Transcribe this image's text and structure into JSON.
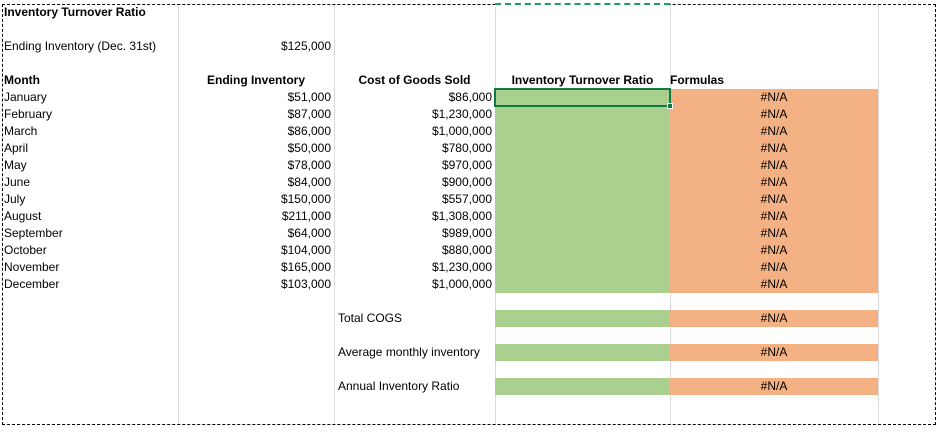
{
  "colors": {
    "green_fill": "#a9d08e",
    "orange_fill": "#f4b183",
    "selection_green": "#107c41",
    "marquee_green": "#1aa05a",
    "gridline": "#d9d9d9"
  },
  "sheet": {
    "title": "Inventory Turnover Ratio",
    "top_label": "Ending Inventory (Dec. 31st)",
    "top_value": "$125,000"
  },
  "table": {
    "headers": [
      "Month",
      "Ending Inventory",
      "Cost of Goods Sold",
      "Inventory Turnover Ratio",
      "Formulas"
    ],
    "rows": [
      {
        "month": "January",
        "ending_inventory": "$51,000",
        "cogs": "$86,000",
        "turnover_ratio": "",
        "formula": "#N/A"
      },
      {
        "month": "February",
        "ending_inventory": "$87,000",
        "cogs": "$1,230,000",
        "turnover_ratio": "",
        "formula": "#N/A"
      },
      {
        "month": "March",
        "ending_inventory": "$86,000",
        "cogs": "$1,000,000",
        "turnover_ratio": "",
        "formula": "#N/A"
      },
      {
        "month": "April",
        "ending_inventory": "$50,000",
        "cogs": "$780,000",
        "turnover_ratio": "",
        "formula": "#N/A"
      },
      {
        "month": "May",
        "ending_inventory": "$78,000",
        "cogs": "$970,000",
        "turnover_ratio": "",
        "formula": "#N/A"
      },
      {
        "month": "June",
        "ending_inventory": "$84,000",
        "cogs": "$900,000",
        "turnover_ratio": "",
        "formula": "#N/A"
      },
      {
        "month": "July",
        "ending_inventory": "$150,000",
        "cogs": "$557,000",
        "turnover_ratio": "",
        "formula": "#N/A"
      },
      {
        "month": "August",
        "ending_inventory": "$211,000",
        "cogs": "$1,308,000",
        "turnover_ratio": "",
        "formula": "#N/A"
      },
      {
        "month": "September",
        "ending_inventory": "$64,000",
        "cogs": "$989,000",
        "turnover_ratio": "",
        "formula": "#N/A"
      },
      {
        "month": "October",
        "ending_inventory": "$104,000",
        "cogs": "$880,000",
        "turnover_ratio": "",
        "formula": "#N/A"
      },
      {
        "month": "November",
        "ending_inventory": "$165,000",
        "cogs": "$1,230,000",
        "turnover_ratio": "",
        "formula": "#N/A"
      },
      {
        "month": "December",
        "ending_inventory": "$103,000",
        "cogs": "$1,000,000",
        "turnover_ratio": "",
        "formula": "#N/A"
      }
    ]
  },
  "summary": {
    "rows": [
      {
        "label": "Total COGS",
        "turnover_ratio": "",
        "formula": "#N/A"
      },
      {
        "label": "Average monthly inventory",
        "turnover_ratio": "",
        "formula": "#N/A"
      },
      {
        "label": "Annual Inventory Ratio",
        "turnover_ratio": "",
        "formula": "#N/A"
      }
    ]
  }
}
